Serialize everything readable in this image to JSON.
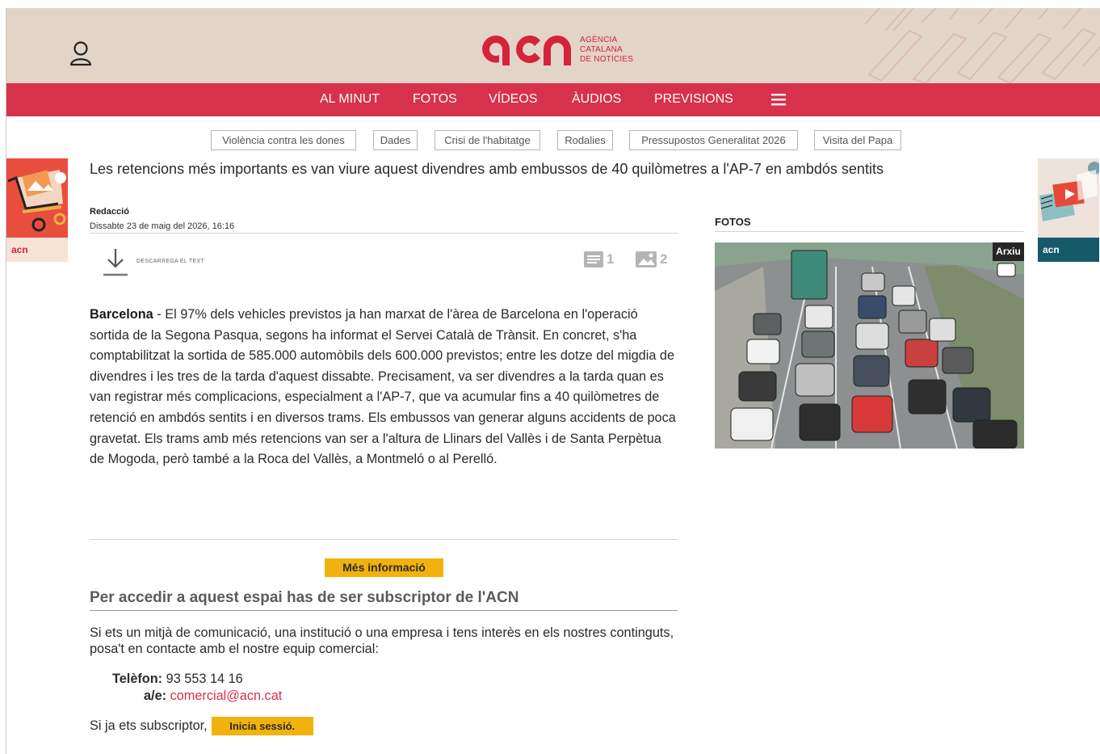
{
  "header": {
    "logo_text": "acn",
    "logo_subtitle_lines": [
      "AGÈNCIA",
      "CATALANA",
      "DE NOTÍCIES"
    ]
  },
  "nav": {
    "items": [
      "AL MINUT",
      "FOTOS",
      "VÍDEOS",
      "ÀUDIOS",
      "PREVISIONS"
    ]
  },
  "tags": [
    "Violència contra les dones",
    "Dades",
    "Crisi de l'habitatge",
    "Rodalies",
    "Pressupostos Generalitat 2026",
    "Visita del Papa"
  ],
  "article": {
    "headline": "Les retencions més importants es van viure aquest divendres amb embussos de 40 quilòmetres a l'AP-7 en ambdós sentits",
    "author": "Redacció",
    "date": "Dissabte 23 de maig del 2026, 16:16",
    "download_label": "DESCARREGA EL TEXT",
    "text_count": "1",
    "photo_count": "2",
    "location": "Barcelona",
    "body": " - El 97% dels vehicles previstos ja han marxat de l'àrea de Barcelona en l'operació sortida de la Segona Pasqua, segons ha informat el Servei Català de Trànsit. En concret, s'ha comptabilitzat la sortida de 585.000 automòbils dels 600.000 previstos; entre les dotze del migdia de divendres i les tres de la tarda d'aquest dissabte. Precisament, va ser divendres a la tarda quan es van registrar més complicacions, especialment a l'AP-7, que va acumular fins a 40 quilòmetres de retenció en ambdós sentits i en diversos trams. Els embussos van generar alguns accidents de poca gravetat. Els trams amb més retencions van ser a l'altura de Llinars del Vallès i de Santa Perpètua de Mogoda, però també a la Roca del Vallès, a Montmeló o al Perelló."
  },
  "more_info": {
    "button_label": "Més informació",
    "title": "Per accedir a aquest espai has de ser subscriptor de l'ACN",
    "text": "Si ets un mitjà de comunicació, una institució o una empresa i tens interès en els nostres continguts, posa't en contacte amb el nostre equip comercial:",
    "phone_label": "Telèfon:",
    "phone": "93 553 14 16",
    "email_label": "a/e:",
    "email": "comercial@acn.cat",
    "login_prefix": "Si ja ets subscriptor,",
    "login_button": "Inicia sessió."
  },
  "sidebar": {
    "photos_label": "FOTOS",
    "photo_badge": "Arxiu"
  },
  "ads": {
    "left_brand": "acn",
    "right_brand": "acn"
  },
  "colors": {
    "header_bg": "#e3d4c8",
    "nav_bg": "#d8314b",
    "brand_red": "#d5223d",
    "button_yellow": "#f2b20d"
  }
}
